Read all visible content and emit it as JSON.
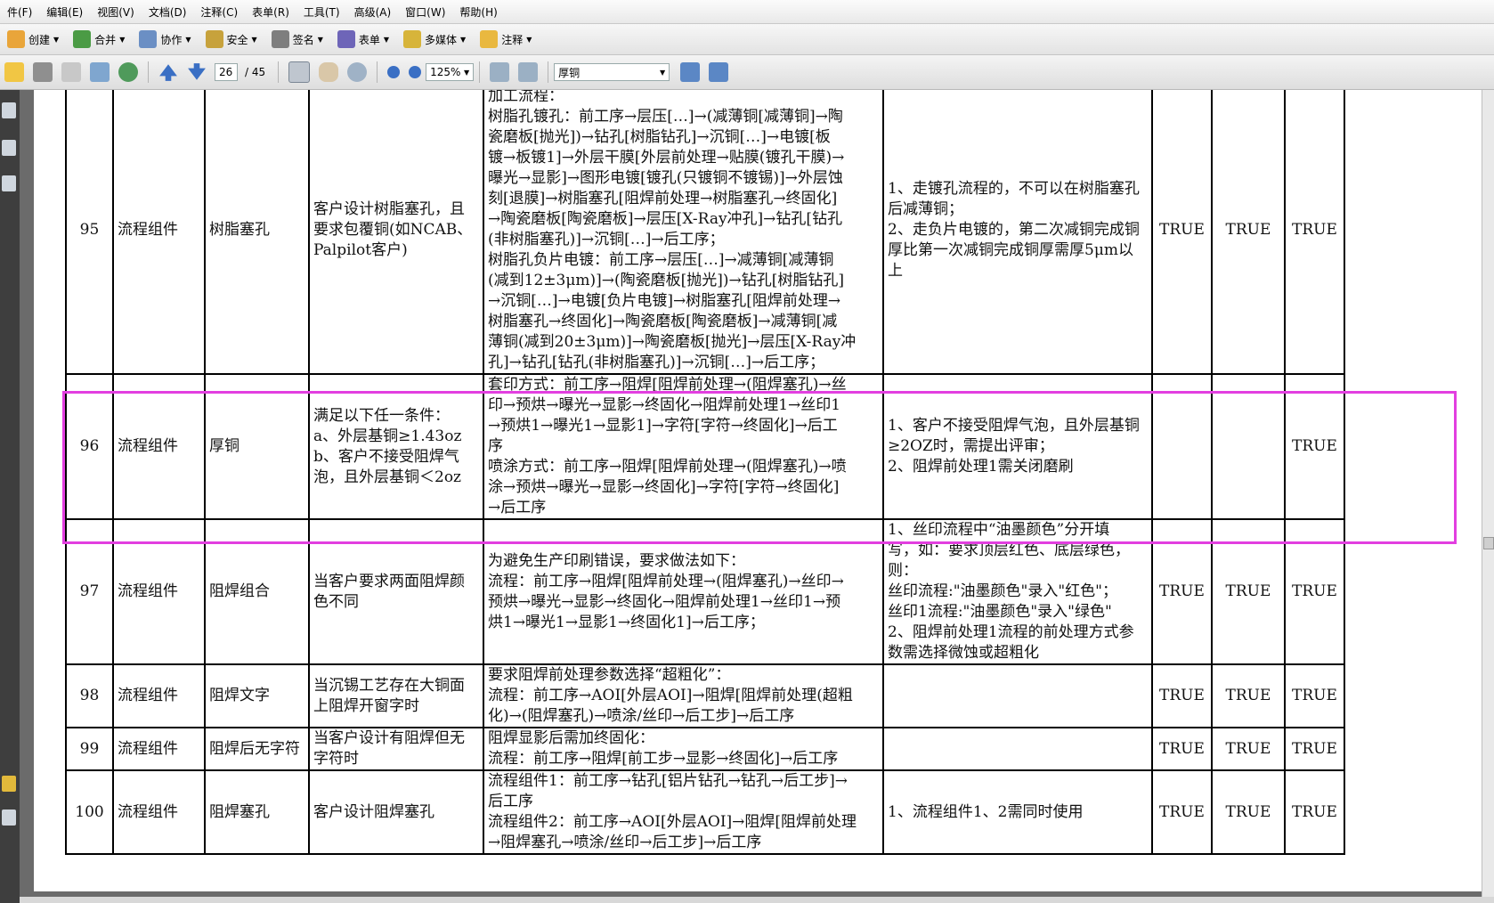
{
  "menu": [
    "件(F)",
    "编辑(E)",
    "视图(V)",
    "文档(D)",
    "注释(C)",
    "表单(R)",
    "工具(T)",
    "高级(A)",
    "窗口(W)",
    "帮助(H)"
  ],
  "toolbar": {
    "buttons": [
      {
        "label": "创建",
        "icon": "create-icon"
      },
      {
        "label": "合并",
        "icon": "combine-icon"
      },
      {
        "label": "协作",
        "icon": "collaborate-icon"
      },
      {
        "label": "安全",
        "icon": "lock-icon"
      },
      {
        "label": "签名",
        "icon": "pen-icon"
      },
      {
        "label": "表单",
        "icon": "form-icon"
      },
      {
        "label": "多媒体",
        "icon": "multimedia-icon"
      },
      {
        "label": "注释",
        "icon": "comment-icon"
      }
    ]
  },
  "nav": {
    "page_current": "26",
    "page_total": "/ 45",
    "zoom": "125%",
    "search_value": "厚铜"
  },
  "table": {
    "rows": [
      {
        "no": "95",
        "category": "流程组件",
        "item": "树脂塞孔",
        "condition": [
          "客户设计树脂塞孔，且",
          "要求包覆铜(如NCAB、",
          "Palpilot客户)"
        ],
        "flow": [
          "加工流程：",
          "树脂孔镀孔：前工序→层压[…]→(减薄铜[减薄铜]→陶",
          "瓷磨板[抛光])→钻孔[树脂钻孔]→沉铜[…]→电镀[板",
          "镀→板镀1]→外层干膜[外层前处理→贴膜(镀孔干膜)→",
          "曝光→显影]→图形电镀[镀孔(只镀铜不镀锡)]→外层蚀",
          "刻[退膜]→树脂塞孔[阻焊前处理→树脂塞孔→终固化]",
          "→陶瓷磨板[陶瓷磨板]→层压[X-Ray冲孔]→钻孔[钻孔",
          "(非树脂塞孔)]→沉铜[…]→后工序；",
          "树脂孔负片电镀：前工序→层压[…]→减薄铜[减薄铜",
          "(减到12±3μm)]→(陶瓷磨板[抛光])→钻孔[树脂钻孔]",
          "→沉铜[…]→电镀[负片电镀]→树脂塞孔[阻焊前处理→",
          "树脂塞孔→终固化]→陶瓷磨板[陶瓷磨板]→减薄铜[减",
          "薄铜(减到20±3μm)]→陶瓷磨板[抛光]→层压[X-Ray冲",
          "孔]→钻孔[钻孔(非树脂塞孔)]→沉铜[…]→后工序；"
        ],
        "note": [
          "1、走镀孔流程的，不可以在树脂塞孔",
          "后减薄铜；",
          "2、走负片电镀的，第二次减铜完成铜",
          "厚比第一次减铜完成铜厚需厚5μm以",
          "上"
        ],
        "t1": "TRUE",
        "t2": "TRUE",
        "t3": "TRUE"
      },
      {
        "no": "96",
        "category": "流程组件",
        "item": "厚铜",
        "condition": [
          "满足以下任一条件：",
          "a、外层基铜≥1.43oz",
          "b、客户不接受阻焊气",
          "泡，且外层基铜＜2oz"
        ],
        "flow": [
          "套印方式：前工序→阻焊[阻焊前处理→(阻焊塞孔)→丝",
          "印→预烘→曝光→显影→终固化→阻焊前处理1→丝印1",
          "→预烘1→曝光1→显影1]→字符[字符→终固化]→后工",
          "序",
          "喷涂方式：前工序→阻焊[阻焊前处理→(阻焊塞孔)→喷",
          "涂→预烘→曝光→显影→终固化]→字符[字符→终固化]",
          "→后工序"
        ],
        "note": [
          "1、客户不接受阻焊气泡，且外层基铜",
          "≥2OZ时，需提出评审；",
          "2、阻焊前处理1需关闭磨刷"
        ],
        "t1": "",
        "t2": "",
        "t3": "TRUE"
      },
      {
        "no": "97",
        "category": "流程组件",
        "item": "阻焊组合",
        "condition": [
          "当客户要求两面阻焊颜",
          "色不同"
        ],
        "flow": [
          "为避免生产印刷错误，要求做法如下：",
          "流程：前工序→阻焊[阻焊前处理→(阻焊塞孔)→丝印→",
          "预烘→曝光→显影→终固化→阻焊前处理1→丝印1→预",
          "烘1→曝光1→显影1→终固化1]→后工序；"
        ],
        "note": [
          "1、丝印流程中“油墨颜色”分开填",
          "写，如：要求顶层红色、底层绿色，",
          "则：",
          "丝印流程:\"油墨颜色\"录入\"红色\"；",
          "丝印1流程:\"油墨颜色\"录入\"绿色\"",
          "2、阻焊前处理1流程的前处理方式参",
          "数需选择微蚀或超粗化"
        ],
        "t1": "TRUE",
        "t2": "TRUE",
        "t3": "TRUE"
      },
      {
        "no": "98",
        "category": "流程组件",
        "item": "阻焊文字",
        "condition": [
          "当沉锡工艺存在大铜面",
          "上阻焊开窗字时"
        ],
        "flow": [
          "要求阻焊前处理参数选择“超粗化”：",
          "流程：前工序→AOI[外层AOI]→阻焊[阻焊前处理(超粗",
          "化)→(阻焊塞孔)→喷涂/丝印→后工步]→后工序"
        ],
        "note": [],
        "t1": "TRUE",
        "t2": "TRUE",
        "t3": "TRUE"
      },
      {
        "no": "99",
        "category": "流程组件",
        "item": "阻焊后无字符",
        "condition": [
          "当客户设计有阻焊但无",
          "字符时"
        ],
        "flow": [
          "阻焊显影后需加终固化：",
          "流程：前工序→阻焊[前工步→显影→终固化]→后工序"
        ],
        "note": [],
        "t1": "TRUE",
        "t2": "TRUE",
        "t3": "TRUE"
      },
      {
        "no": "100",
        "category": "流程组件",
        "item": "阻焊塞孔",
        "condition": [
          "客户设计阻焊塞孔"
        ],
        "flow": [
          "流程组件1：前工序→钻孔[铝片钻孔→钻孔→后工步]→",
          "后工序",
          "流程组件2：前工序→AOI[外层AOI]→阻焊[阻焊前处理",
          "→阻焊塞孔→喷涂/丝印→后工步]→后工序"
        ],
        "note": [
          "1、流程组件1、2需同时使用"
        ],
        "t1": "TRUE",
        "t2": "TRUE",
        "t3": "TRUE"
      }
    ]
  }
}
